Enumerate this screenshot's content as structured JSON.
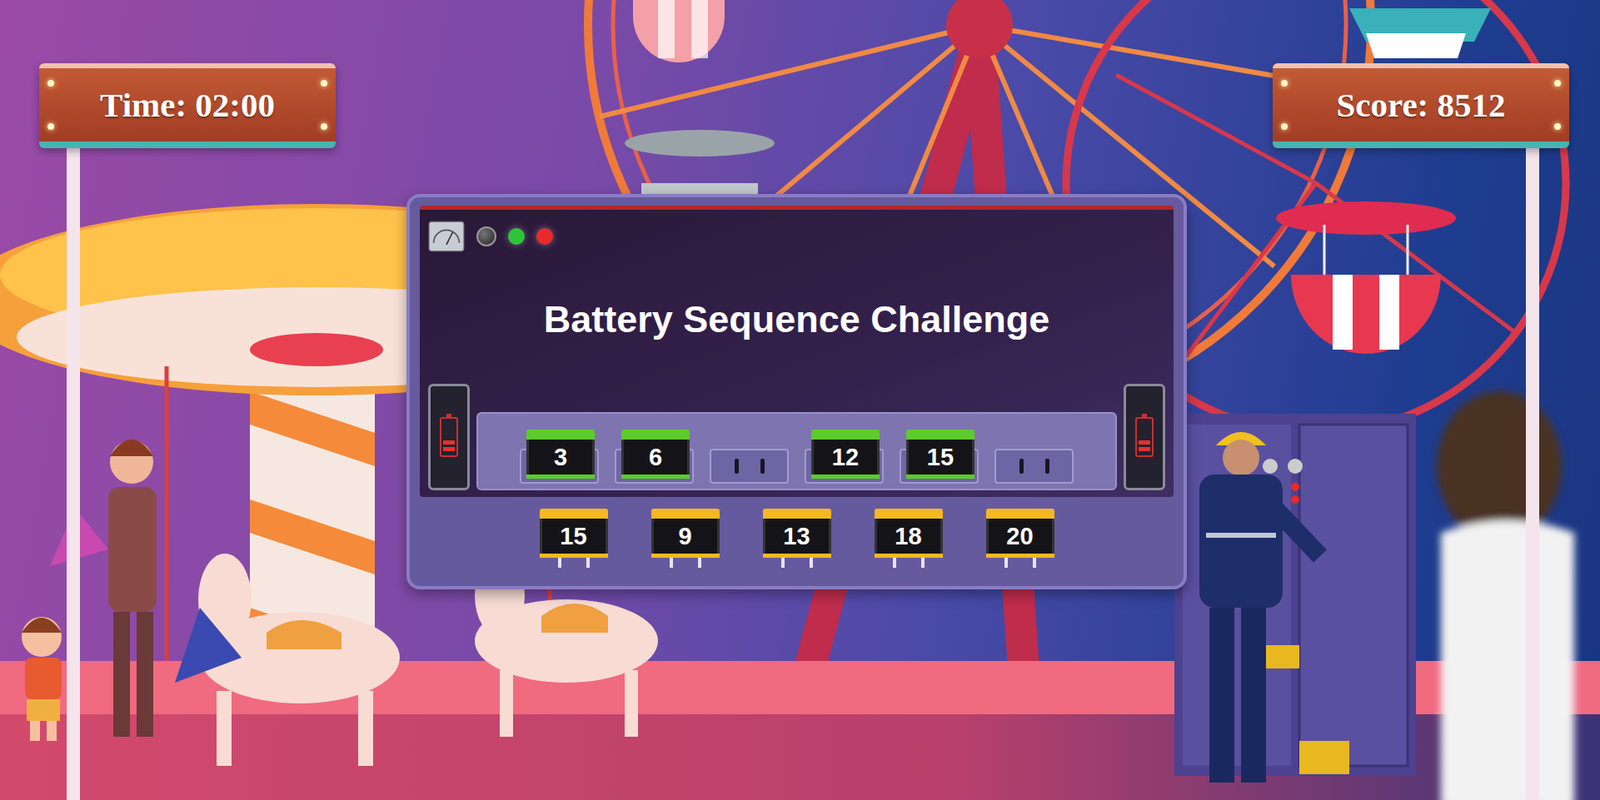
{
  "hud": {
    "time": "Time: 02:00",
    "score": "Score: 8512"
  },
  "panel": {
    "title": "Battery Sequence Challenge",
    "lamps": [
      {
        "name": "green-lamp",
        "on": true,
        "color": "#2ec43a"
      },
      {
        "name": "red-lamp",
        "on": true,
        "color": "#e82a2a"
      }
    ]
  },
  "side_batteries": [
    {
      "side": "left",
      "level": 0.4
    },
    {
      "side": "right",
      "level": 0.4
    }
  ],
  "slots": [
    {
      "value": "3",
      "filled": true
    },
    {
      "value": "6",
      "filled": true
    },
    {
      "value": "",
      "filled": false
    },
    {
      "value": "12",
      "filled": true
    },
    {
      "value": "15",
      "filled": true
    },
    {
      "value": "",
      "filled": false
    }
  ],
  "choices": [
    "15",
    "9",
    "13",
    "18",
    "20"
  ]
}
